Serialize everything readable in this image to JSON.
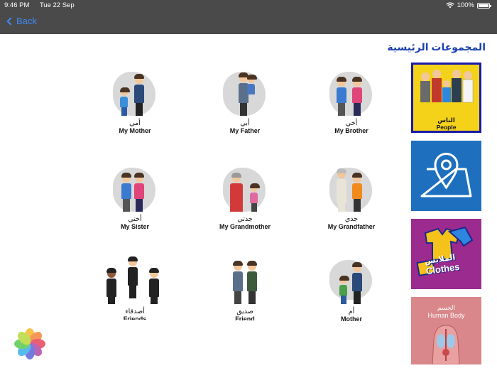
{
  "status_bar": {
    "time": "9:46 PM",
    "date": "Tue 22 Sep",
    "battery": "100%",
    "battery_level": 1.0
  },
  "nav": {
    "back_label": "Back"
  },
  "section_title": "المجموعات الرئيسية",
  "cards": [
    {
      "ar": "أمي",
      "en": "My Mother"
    },
    {
      "ar": "أبي",
      "en": "My Father"
    },
    {
      "ar": "أخي",
      "en": "My Brother"
    },
    {
      "ar": "أختي",
      "en": "My Sister"
    },
    {
      "ar": "جدتي",
      "en": "My Grandmother"
    },
    {
      "ar": "جدي",
      "en": "My Grandfather"
    },
    {
      "ar": "أصدقاء",
      "en": "Friends"
    },
    {
      "ar": "صديق",
      "en": "Friend"
    },
    {
      "ar": "أم",
      "en": "Mother"
    }
  ],
  "sidebar": {
    "people": {
      "ar": "الناس",
      "en": "People"
    },
    "clothes": {
      "ar": "الملابس",
      "en": "Clothes"
    },
    "body": {
      "ar": "الجسم",
      "en": "Human Body"
    }
  },
  "colors": {
    "topbar": "#4a4a4a",
    "back": "#3d8bf5",
    "title": "#1a3fb0",
    "people_tile": "#f4d21a",
    "map_tile": "#1e70bf",
    "clothes_tile": "#9b2b8e",
    "body_tile": "#d9878a"
  }
}
